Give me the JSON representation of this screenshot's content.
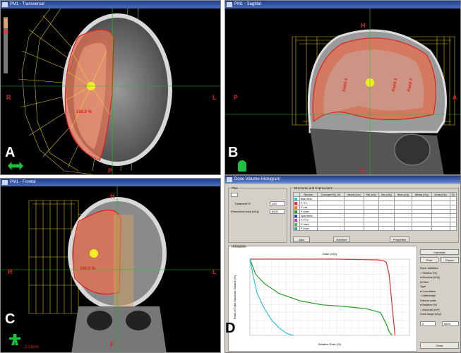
{
  "panels": {
    "a": {
      "title": "PM1 - Transversal",
      "letter": "A",
      "orient": {
        "left": "R",
        "right": "L",
        "bottom": "P"
      }
    },
    "b": {
      "title": "PM1 - Sagittal",
      "letter": "B",
      "orient": {
        "left": "P",
        "right": "A",
        "top": "H",
        "bottom": "F"
      }
    },
    "c": {
      "title": "PM1 - Frontal",
      "letter": "C",
      "orient": {
        "left": "R",
        "right": "L",
        "top": "H",
        "bottom": "F"
      },
      "scale": "2.18cm"
    },
    "d": {
      "title": "Dose Volume Histogram"
    }
  },
  "dvh": {
    "plan_group": "Plan",
    "prescription_label_1": "Treatment %",
    "prescription_value_1": "100",
    "prescription_label_2": "Prescribed dose (cGy)",
    "prescription_value_2": "6000",
    "structures_group": "Structures and Expressions",
    "columns": [
      "",
      "Structure",
      "Coverage (%) | (%)",
      "Volume (cm³)",
      "Min (cGy)",
      "Max (cGy)",
      "Mean (cGy)",
      "Median (cGy)",
      "Modal (cGy)",
      "SD"
    ],
    "rows": [
      {
        "color": "#2fc0e0",
        "name": "Brain Stem"
      },
      {
        "color": "#e03030",
        "name": "P / TV"
      },
      {
        "color": "#e08020",
        "name": "P / red"
      },
      {
        "color": "#20a020",
        "name": "P / brain"
      },
      {
        "color": "#3040d0",
        "name": "Optic Nerve"
      },
      {
        "color": "#c040c0",
        "name": "P / PTV"
      },
      {
        "color": "#40c040",
        "name": "P / brain"
      },
      {
        "color": "#30a0a0",
        "name": "P / brain"
      }
    ],
    "row_buttons": [
      "Add",
      "Remove",
      "Properties"
    ],
    "histogram_group": "Histogram",
    "x_axis_top": "Dose (cGy)",
    "x_axis_bottom": "Relative Dose (%)",
    "y_axis": "Ratio of Total Structure Volume (%)",
    "buttons": {
      "calculate": "Calculate",
      "print": "Print",
      "export": "Export",
      "close": "Close"
    },
    "options": {
      "dose_statistics": "Dose statistics",
      "relative": "Relative [%]",
      "absolute": "Absolute [cGy]",
      "grid": "Grid",
      "type": "Type",
      "cumulative": "Cumulative",
      "differential": "Differential",
      "volume_scale": "Volume scale",
      "vrel": "Relative [%]",
      "vabs": "Absolute [cm³]",
      "dose_range": "Dose range [cGy]",
      "range_from": "0",
      "range_to": "6500"
    }
  },
  "colors": {
    "isodose": "#e06040",
    "beam": "#d4c020",
    "contour_green": "#20c020",
    "ptv_red": "#e02020",
    "oar_cyan": "#2fc0e0"
  },
  "chart_data": {
    "type": "line",
    "title": "",
    "xlabel": "Relative Dose (%)",
    "ylabel": "Ratio of Total Structure Volume (%)",
    "xlim": [
      0,
      110
    ],
    "ylim": [
      0,
      100
    ],
    "grid": true,
    "series": [
      {
        "color": "#e03030",
        "x": [
          0,
          10,
          30,
          60,
          88,
          92,
          94,
          96,
          98,
          100
        ],
        "y": [
          100,
          100,
          100,
          100,
          99,
          98,
          96,
          80,
          40,
          0
        ]
      },
      {
        "color": "#20a020",
        "x": [
          0,
          4,
          10,
          20,
          35,
          50,
          65,
          80,
          90,
          94,
          96,
          98
        ],
        "y": [
          100,
          80,
          68,
          55,
          45,
          40,
          38,
          35,
          30,
          15,
          5,
          0
        ]
      },
      {
        "color": "#2fc0e0",
        "x": [
          0,
          2,
          5,
          10,
          15,
          20,
          25,
          28,
          30
        ],
        "y": [
          100,
          80,
          55,
          35,
          20,
          10,
          3,
          1,
          0
        ]
      }
    ]
  }
}
